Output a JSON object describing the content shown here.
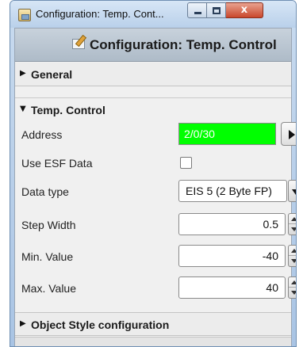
{
  "window": {
    "title": "Configuration: Temp. Cont...",
    "app_icon": "app-icon",
    "close_glyph": "x"
  },
  "header": {
    "title": "Configuration: Temp. Control",
    "icon": "edit-config-icon"
  },
  "sections": {
    "general": {
      "label": "General",
      "expanded": false
    },
    "temp_control": {
      "label": "Temp. Control",
      "expanded": true
    },
    "object_style": {
      "label": "Object Style configuration",
      "expanded": false
    }
  },
  "fields": {
    "address": {
      "label": "Address",
      "value": "2/0/30",
      "bg_color": "#00ff00",
      "text_color": "#ffffff"
    },
    "use_esf": {
      "label": "Use ESF Data",
      "checked": false
    },
    "data_type": {
      "label": "Data type",
      "value": "EIS 5 (2 Byte FP)"
    },
    "step_width": {
      "label": "Step Width",
      "value": "0.5"
    },
    "min_value": {
      "label": "Min. Value",
      "value": "-40"
    },
    "max_value": {
      "label": "Max. Value",
      "value": "40"
    }
  },
  "glyphs": {
    "collapsed": "▶",
    "expanded": "▼"
  }
}
